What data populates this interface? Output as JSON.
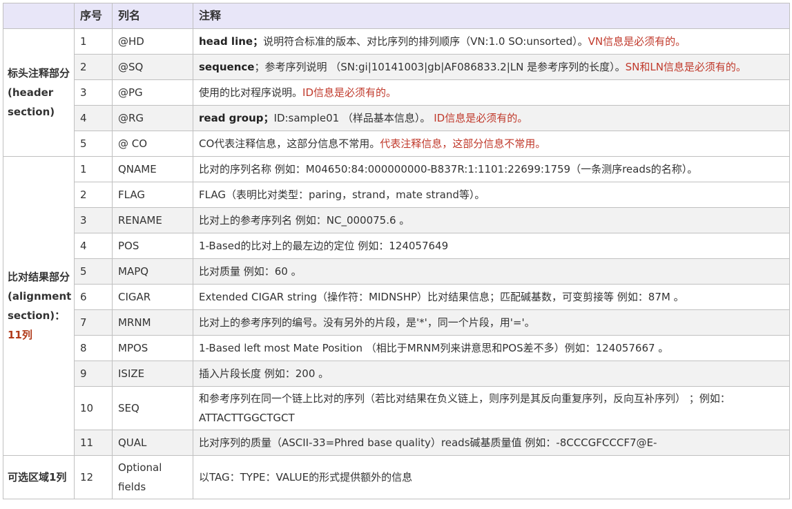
{
  "header": {
    "section": "",
    "no": "序号",
    "col": "列名",
    "desc": "注释"
  },
  "sections": {
    "header_section": "标头注释部分(header section)",
    "alignment_section": "比对结果部分(alignment section)：",
    "alignment_note": "11列",
    "optional_section": "可选区域1列"
  },
  "header_rows": [
    {
      "no": "1",
      "col": "@HD",
      "bold": "head line；",
      "text": "说明符合标准的版本、对比序列的排列顺序（VN:1.0 SO:unsorted）。",
      "red": "VN信息是必须有的。"
    },
    {
      "no": "2",
      "col": "@SQ",
      "bold": "sequence",
      "text": "；参考序列说明 （SN:gi|10141003|gb|AF086833.2|LN 是参考序列的长度）。",
      "red": "SN和LN信息是必须有的。"
    },
    {
      "no": "3",
      "col": "@PG",
      "bold": "",
      "text": "使用的比对程序说明。",
      "red": "ID信息是必须有的。"
    },
    {
      "no": "4",
      "col": "@RG",
      "bold": "read group；",
      "text": "ID:sample01 （样品基本信息）。 ",
      "red": "ID信息是必须有的。"
    },
    {
      "no": "5",
      "col": "@ CO",
      "bold": "",
      "text": "CO代表注释信息，这部分信息不常用。",
      "red": "代表注释信息，这部分信息不常用。"
    }
  ],
  "alignment_rows": [
    {
      "no": "1",
      "col": "QNAME",
      "text": "比对的序列名称 例如：M04650:84:000000000-B837R:1:1101:22699:1759（一条测序reads的名称）。"
    },
    {
      "no": "2",
      "col": "FLAG",
      "text": "FLAG（表明比对类型：paring，strand，mate strand等）。"
    },
    {
      "no": "3",
      "col": "RENAME",
      "text": "比对上的参考序列名 例如：NC_000075.6 。"
    },
    {
      "no": "4",
      "col": "POS",
      "text": "1-Based的比对上的最左边的定位 例如：124057649"
    },
    {
      "no": "5",
      "col": "MAPQ",
      "text": "比对质量 例如：60 。"
    },
    {
      "no": "6",
      "col": "CIGAR",
      "text": "Extended CIGAR string（操作符：MIDNSHP）比对结果信息；匹配碱基数，可变剪接等 例如：87M 。"
    },
    {
      "no": "7",
      "col": "MRNM",
      "text": "比对上的参考序列的编号。没有另外的片段，是'*'，同一个片段，用'='。"
    },
    {
      "no": "8",
      "col": "MPOS",
      "text": "1-Based left most Mate Position （相比于MRNM列来讲意思和POS差不多）例如：124057667 。"
    },
    {
      "no": "9",
      "col": "ISIZE",
      "text": "插入片段长度 例如：200 。"
    },
    {
      "no": "10",
      "col": "SEQ",
      "text": "和参考序列在同一个链上比对的序列（若比对结果在负义链上，则序列是其反向重复序列，反向互补序列） ；例如：ATTACTTGGCTGCT"
    },
    {
      "no": "11",
      "col": "QUAL",
      "text": "比对序列的质量（ASCII-33=Phred base quality）reads碱基质量值 例如：-8CCCGFCCCF7@E-"
    }
  ],
  "optional_rows": [
    {
      "no": "12",
      "col": "Optional fields",
      "text": "以TAG：TYPE：VALUE的形式提供额外的信息"
    }
  ],
  "colors": {
    "header_bg": "#e8e6f8",
    "stripe_bg": "#f2f2f2",
    "red_text": "#c0392b",
    "border": "#c0c0c0"
  }
}
